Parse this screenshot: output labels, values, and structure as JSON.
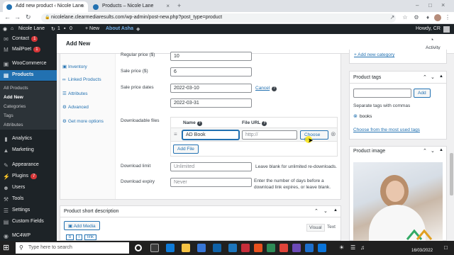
{
  "browser": {
    "tabs": [
      {
        "title": "Add new product ‹ Nicole Lane",
        "close": "×"
      },
      {
        "title": "Products – Nicole Lane",
        "close": "×"
      }
    ],
    "new_tab": "+",
    "url": "nicolelane.clearmediaresults.com/wp-admin/post-new.php?post_type=product"
  },
  "adminbar": {
    "site_name": "Nicole Lane",
    "updates": "1",
    "comments": "0",
    "new_label": "+ New",
    "about_label": "About Asha",
    "howdy": "Howdy, CR"
  },
  "sidebar": {
    "items": [
      {
        "label": "Contact",
        "badge": "1",
        "icon": "mail-icon"
      },
      {
        "label": "MailPoet",
        "badge": "1",
        "icon": "mailpoet-icon"
      },
      {
        "label": "WooCommerce",
        "icon": "woo-icon"
      },
      {
        "label": "Products",
        "icon": "box-icon"
      },
      {
        "label": "Analytics",
        "icon": "chart-icon"
      },
      {
        "label": "Marketing",
        "icon": "megaphone-icon"
      },
      {
        "label": "Appearance",
        "icon": "brush-icon"
      },
      {
        "label": "Plugins",
        "badge": "7",
        "icon": "plug-icon"
      },
      {
        "label": "Users",
        "icon": "user-icon"
      },
      {
        "label": "Tools",
        "icon": "wrench-icon"
      },
      {
        "label": "Settings",
        "icon": "settings-icon"
      },
      {
        "label": "Custom Fields",
        "icon": "fields-icon"
      },
      {
        "label": "MC4WP",
        "icon": "mc4wp-icon"
      }
    ],
    "products_sub": [
      "All Products",
      "Add New",
      "Categories",
      "Tags",
      "Attributes"
    ]
  },
  "header": {
    "title": "Add New",
    "activity": "Activity"
  },
  "product_data": {
    "tabs": [
      "Inventory",
      "Linked Products",
      "Attributes",
      "Advanced",
      "Get more options"
    ],
    "regular_price_label": "Regular price ($)",
    "regular_price": "10",
    "sale_price_label": "Sale price ($)",
    "sale_price": "6",
    "sale_dates_label": "Sale price dates",
    "sale_from": "2022-03-10",
    "sale_to": "2022-03-31",
    "cancel": "Cancel",
    "downloadable_label": "Downloadable files",
    "col_name": "Name",
    "col_url": "File URL",
    "file_name": "AD Book",
    "file_url_placeholder": "http://",
    "choose_file": "Choose file",
    "add_file": "Add File",
    "download_limit_label": "Download limit",
    "download_limit_placeholder": "Unlimited",
    "download_limit_hint": "Leave blank for unlimited re-downloads.",
    "download_expiry_label": "Download expiry",
    "download_expiry_placeholder": "Never",
    "download_expiry_hint": "Enter the number of days before a download link expires, or leave blank."
  },
  "short_description": {
    "title": "Product short description",
    "add_media": "Add Media",
    "visual": "Visual",
    "text": "Text",
    "quick_buttons": [
      "b",
      "i",
      "link"
    ]
  },
  "right": {
    "add_category": "+ Add new category",
    "tags_title": "Product tags",
    "add_button": "Add",
    "tags_hint": "Separate tags with commas",
    "tag": "books",
    "most_used": "Choose from the most used tags",
    "image_title": "Product image"
  },
  "taskbar": {
    "search_placeholder": "Type here to search",
    "date": "16/03/2022"
  }
}
